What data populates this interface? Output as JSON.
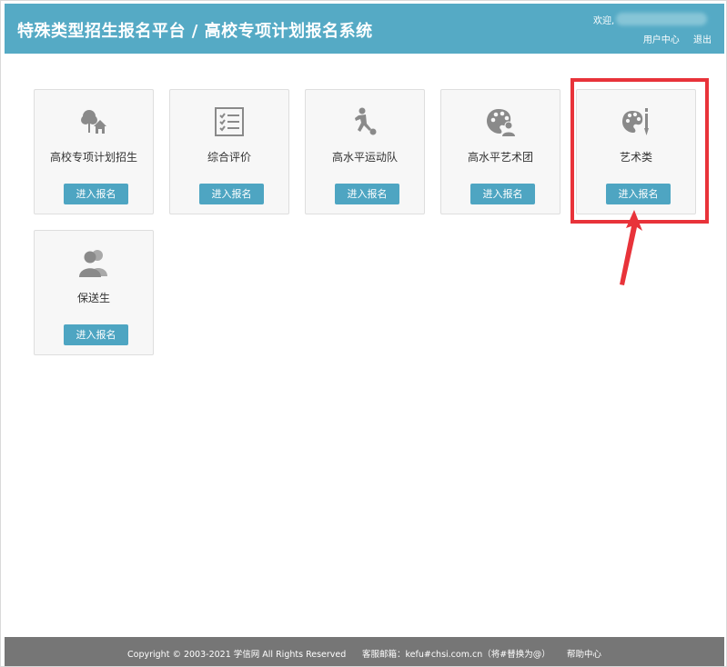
{
  "header": {
    "title": "特殊类型招生报名平台 / 高校专项计划报名系统",
    "welcome": "欢迎,",
    "user_center": "用户中心",
    "logout": "退出"
  },
  "cards": [
    {
      "label": "高校专项计划招生",
      "button": "进入报名",
      "icon": "tree-house-icon"
    },
    {
      "label": "综合评价",
      "button": "进入报名",
      "icon": "checklist-icon"
    },
    {
      "label": "高水平运动队",
      "button": "进入报名",
      "icon": "soccer-player-icon"
    },
    {
      "label": "高水平艺术团",
      "button": "进入报名",
      "icon": "palette-person-icon"
    },
    {
      "label": "艺术类",
      "button": "进入报名",
      "icon": "palette-brush-icon"
    },
    {
      "label": "保送生",
      "button": "进入报名",
      "icon": "users-icon"
    }
  ],
  "footer": {
    "copyright": "Copyright © 2003-2021 学信网 All Rights Reserved",
    "email": "客服邮箱：kefu#chsi.com.cn（将#替换为@）",
    "help": "帮助中心"
  },
  "colors": {
    "header_bg": "#55aac5",
    "button_bg": "#4ea5c2",
    "card_bg": "#f7f7f7",
    "highlight": "#e8333a",
    "footer_bg": "#767676",
    "icon_gray": "#8a8a8a"
  }
}
